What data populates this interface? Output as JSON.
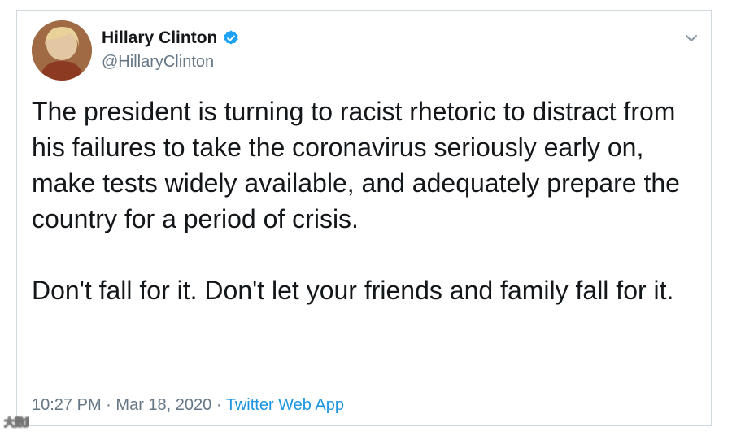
{
  "tweet": {
    "author": {
      "display_name": "Hillary Clinton",
      "handle": "@HillaryClinton",
      "verified": true,
      "avatar_icon": "profile-photo"
    },
    "paragraphs": [
      "The president is turning to racist rhetoric to distract from his failures to take the coronavirus seriously early on, make tests widely available, and adequately prepare the country for a period of crisis.",
      "Don't fall for it. Don't let your friends and family fall for it."
    ],
    "time": "10:27 PM",
    "date": "Mar 18, 2020",
    "separator": "·",
    "source": "Twitter Web App",
    "menu_icon": "chevron-down-icon"
  },
  "watermark": {
    "text": "大数跨境"
  },
  "colors": {
    "text": "#14171a",
    "secondary": "#657786",
    "link": "#1b95e0",
    "verified": "#1da1f2",
    "border": "#cfd9de"
  }
}
